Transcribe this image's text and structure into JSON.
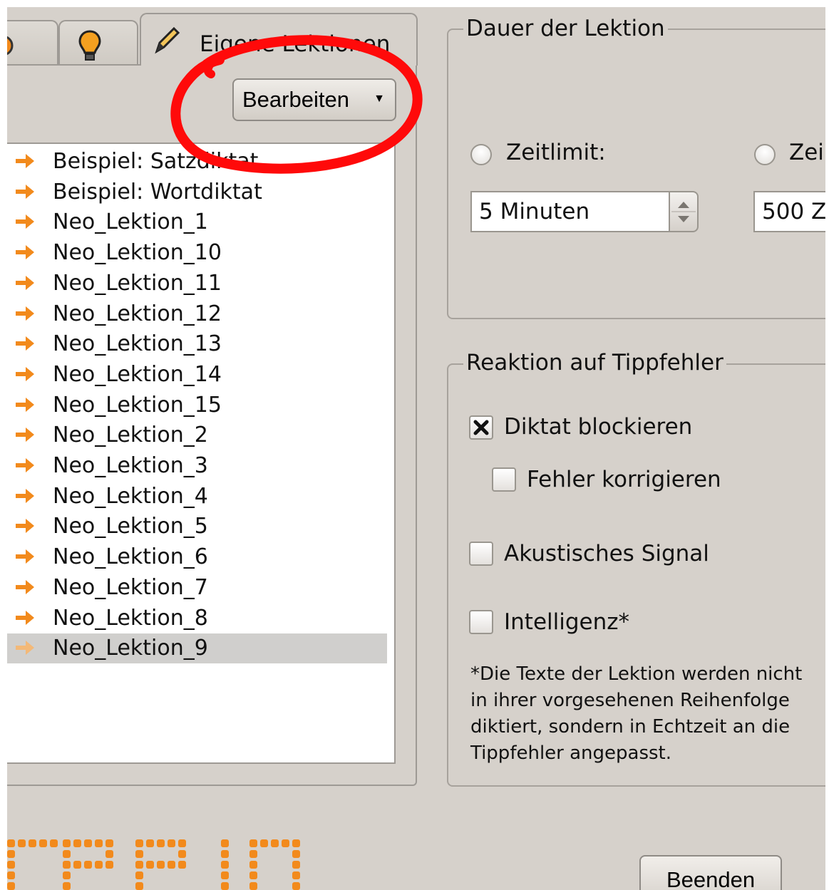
{
  "tabs": [
    {
      "icon": "orange-circle-icon"
    },
    {
      "icon": "lightbulb-icon"
    },
    {
      "icon": "pencil-icon",
      "label": "Eigene Lektionen"
    }
  ],
  "toolbar": {
    "edit_button": "Bearbeiten"
  },
  "lessons": [
    "Beispiel: Satzdiktat",
    "Beispiel: Wortdiktat",
    "Neo_Lektion_1",
    "Neo_Lektion_10",
    "Neo_Lektion_11",
    "Neo_Lektion_12",
    "Neo_Lektion_13",
    "Neo_Lektion_14",
    "Neo_Lektion_15",
    "Neo_Lektion_2",
    "Neo_Lektion_3",
    "Neo_Lektion_4",
    "Neo_Lektion_5",
    "Neo_Lektion_6",
    "Neo_Lektion_7",
    "Neo_Lektion_8",
    "Neo_Lektion_9"
  ],
  "selected_lesson": "Neo_Lektion_9",
  "duration": {
    "title": "Dauer der Lektion",
    "time_limit_label": "Zeitlimit:",
    "time_limit_value": "5 Minuten",
    "char_limit_label": "Zei",
    "char_limit_value": "500 Z"
  },
  "errors": {
    "title": "Reaktion auf Tippfehler",
    "block_label": "Diktat blockieren",
    "block_checked": true,
    "correct_label": "Fehler korrigieren",
    "correct_checked": false,
    "signal_label": "Akustisches Signal",
    "signal_checked": false,
    "intelligence_label": "Intelligenz*",
    "intelligence_checked": false,
    "note": "*Die Texte der Lektion werden nicht\nin ihrer vorgesehenen Reihenfolge\ndiktiert, sondern in Echtzeit an die\nTippfehler angepasst."
  },
  "footer": {
    "quit_button": "Beenden"
  },
  "colors": {
    "accent": "#f28a1c",
    "annotation": "#ff0a0a",
    "panel": "#d6d1cb"
  }
}
